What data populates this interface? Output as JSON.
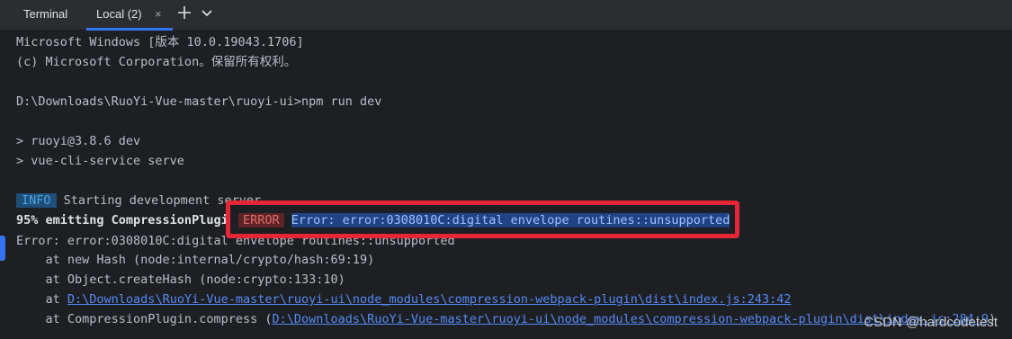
{
  "tabbar": {
    "tool_title": "Terminal",
    "tab_label": "Local (2)",
    "close_glyph": "×",
    "icons": [
      "close-icon",
      "plus-icon",
      "chevron-down-icon"
    ]
  },
  "terminal": {
    "lines": [
      "Microsoft Windows [版本 10.0.19043.1706]",
      "(c) Microsoft Corporation。保留所有权利。",
      "D:\\Downloads\\RuoYi-Vue-master\\ruoyi-ui>npm run dev",
      "> ruoyi@3.8.6 dev",
      "> vue-cli-service serve",
      "Error: error:0308010C:digital envelope routines::unsupported",
      "    at new Hash (node:internal/crypto/hash:69:19)",
      "    at Object.createHash (node:crypto:133:10)"
    ],
    "info_badge": "INFO",
    "info_text": " Starting development server...",
    "emit_text": "95% emitting CompressionPlugin",
    "stack_line_8_prefix": "    at ",
    "stack_line_8_link": "D:\\Downloads\\RuoYi-Vue-master\\ruoyi-ui\\node_modules\\compression-webpack-plugin\\dist\\index.js:243:42",
    "stack_line_9_prefix": "    at CompressionPlugin.compress (",
    "stack_line_9_link": "D:\\Downloads\\RuoYi-Vue-master\\ruoyi-ui\\node_modules\\compression-webpack-plugin\\dist\\index.js:284:9",
    "stack_line_9_suffix": ")"
  },
  "highlight": {
    "error_badge": "ERROR",
    "error_message": "Error: error:0308010C:digital envelope routines::unsupported",
    "box_color": "#e62636"
  },
  "watermark": "CSDN @hardcodetest",
  "colors": {
    "background": "#1e1f22",
    "tabbar": "#2b2d30",
    "accent": "#3574f0",
    "link": "#548af7",
    "info_badge_bg": "#1f4e79",
    "error_badge_bg": "#5c2426",
    "selection_bg": "#214283"
  }
}
